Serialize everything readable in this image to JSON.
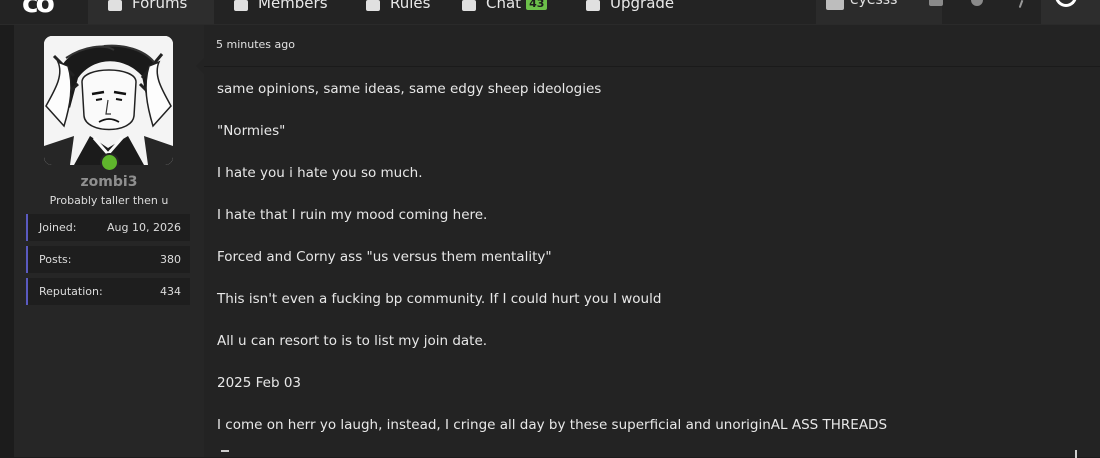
{
  "nav": {
    "logo": "co",
    "tabs": [
      {
        "label": "Forums",
        "icon": "chat-bubbles-icon",
        "active": true
      },
      {
        "label": "Members",
        "icon": "users-icon"
      },
      {
        "label": "Rules",
        "icon": "document-icon"
      },
      {
        "label": "Chat",
        "icon": "chat-icon",
        "badge": "43"
      },
      {
        "label": "Upgrade",
        "icon": "upgrade-icon"
      }
    ],
    "user": {
      "name": "eyesss"
    },
    "icons": [
      "inbox-icon",
      "bell-icon",
      "search-icon",
      "theme-toggle-icon"
    ]
  },
  "author": {
    "name": "zombi3",
    "title": "Probably taller then u",
    "status": "online",
    "stats": [
      {
        "label": "Joined:",
        "value": "Aug 10, 2026"
      },
      {
        "label": "Posts:",
        "value": "380"
      },
      {
        "label": "Reputation:",
        "value": "434"
      }
    ]
  },
  "post": {
    "timestamp": "5 minutes ago",
    "lines": [
      "same opinions, same ideas, same edgy sheep ideologies",
      "\"Normies\"",
      "I hate you i hate you so much.",
      "I hate that I ruin my mood coming here.",
      "Forced and Corny ass \"us versus them mentality\"",
      "This isn't even a fucking bp community. If I could hurt you I would",
      "All u can resort to is to list my join date.",
      "2025 Feb 03",
      "I come on herr yo laugh, instead, I cringe all day by these superficial and unoriginAL ASS THREADS"
    ]
  },
  "colors": {
    "accent": "#5a5ac0",
    "online": "#5fb62c",
    "badge": "#6cc04a"
  }
}
